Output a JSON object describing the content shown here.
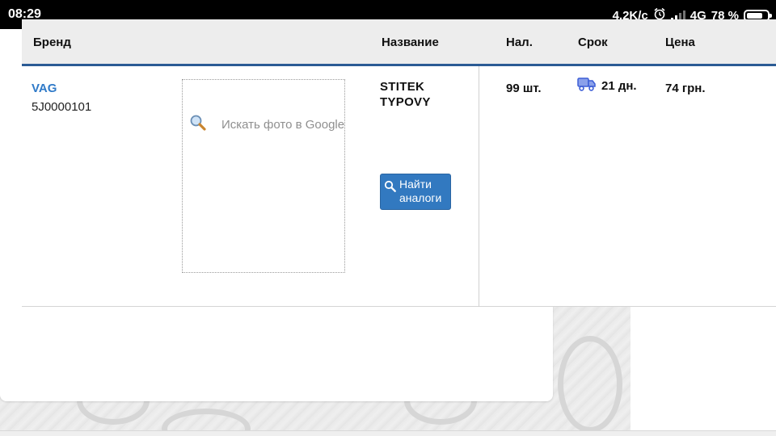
{
  "status_bar": {
    "time": "08:29",
    "net_speed": "4.2K/c",
    "network": "4G",
    "battery": "78 %",
    "battery_level": 0.78
  },
  "table": {
    "headers": {
      "brand": "Бренд",
      "name": "Название",
      "stock": "Нал.",
      "term": "Срок",
      "price": "Цена"
    },
    "row": {
      "brand": "VAG",
      "article": "5J0000101",
      "google_photo": "Искать фото в Google",
      "name": "STITEK TYPOVY",
      "find_analogs": "Найти аналоги",
      "stock": "99 шт.",
      "term": "21 дн.",
      "price": "74 грн."
    }
  },
  "colors": {
    "accent": "#3279c0",
    "link": "#2f7ac8",
    "header_bg": "#ededed",
    "header_border": "#2b5b94"
  },
  "icons": [
    "alarm-icon",
    "signal-icon",
    "battery-icon",
    "magnifier-icon",
    "truck-icon"
  ]
}
